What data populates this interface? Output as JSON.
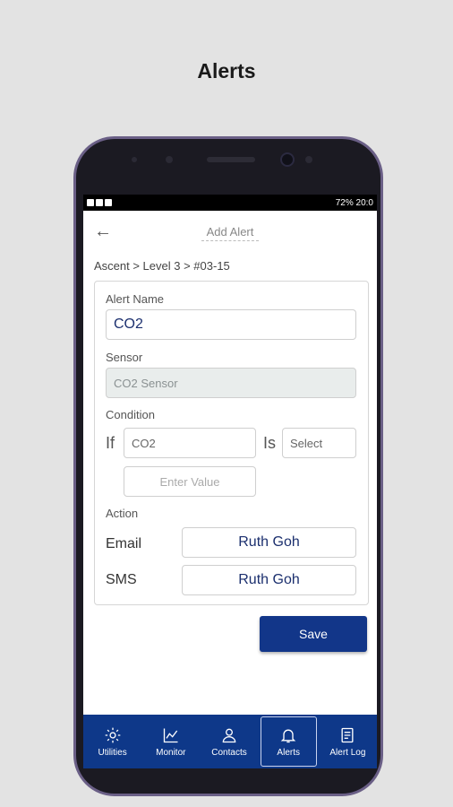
{
  "page_title": "Alerts",
  "status_bar": {
    "right": "72% 20:0"
  },
  "screen": {
    "title": "Add Alert",
    "breadcrumb": "Ascent > Level 3 > #03-15"
  },
  "form": {
    "alert_name_label": "Alert Name",
    "alert_name_value": "CO2",
    "sensor_label": "Sensor",
    "sensor_value": "CO2 Sensor",
    "condition_label": "Condition",
    "if_label": "If",
    "condition_field_value": "CO2",
    "is_label": "Is",
    "operator_select_value": "Select",
    "value_placeholder": "Enter Value",
    "action_label": "Action",
    "email_label": "Email",
    "email_value": "Ruth Goh",
    "sms_label": "SMS",
    "sms_value": "Ruth Goh"
  },
  "save_label": "Save",
  "nav": {
    "items": [
      {
        "label": "Utilities",
        "icon": "gear-icon"
      },
      {
        "label": "Monitor",
        "icon": "chart-line-icon"
      },
      {
        "label": "Contacts",
        "icon": "user-icon"
      },
      {
        "label": "Alerts",
        "icon": "bell-icon",
        "active": true
      },
      {
        "label": "Alert Log",
        "icon": "log-icon"
      }
    ]
  },
  "colors": {
    "primary": "#0e3889",
    "text_value": "#1b2f6e",
    "background": "#e3e3e3"
  }
}
